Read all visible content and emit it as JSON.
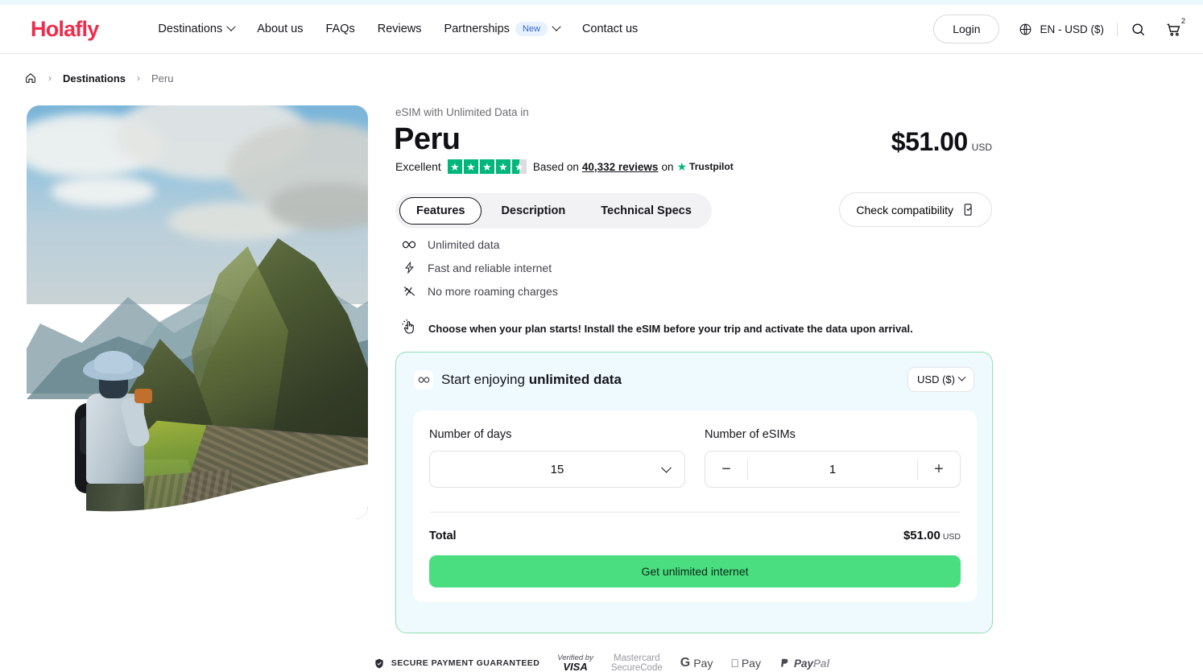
{
  "header": {
    "logo": "Holafly",
    "nav": [
      {
        "label": "Destinations",
        "has_chevron": true,
        "badge": null
      },
      {
        "label": "About us",
        "has_chevron": false,
        "badge": null
      },
      {
        "label": "FAQs",
        "has_chevron": false,
        "badge": null
      },
      {
        "label": "Reviews",
        "has_chevron": false,
        "badge": null
      },
      {
        "label": "Partnerships",
        "has_chevron": true,
        "badge": "New"
      },
      {
        "label": "Contact us",
        "has_chevron": false,
        "badge": null
      }
    ],
    "login_label": "Login",
    "locale": "EN - USD ($)",
    "locale_icon": "globe-icon",
    "search_icon": "search-icon",
    "cart_icon": "cart-icon",
    "cart_count": "2"
  },
  "breadcrumb": {
    "home_icon": "home-icon",
    "separator": "›",
    "items": [
      {
        "label": "Destinations"
      },
      {
        "label": "Peru"
      }
    ]
  },
  "hero": {
    "alt": "photographer-overlooking-machu-picchu"
  },
  "product": {
    "eyebrow": "eSIM with Unlimited Data in",
    "title": "Peru",
    "price_amount": "$51.00",
    "price_currency": "USD"
  },
  "rating": {
    "word": "Excellent",
    "stars": 4.5,
    "star_color": "#00b67a",
    "prefix": "Based on",
    "reviews_count": "40,332 reviews",
    "on_label": "on",
    "brand": "Trustpilot"
  },
  "tabs": [
    {
      "label": "Features",
      "active": true
    },
    {
      "label": "Description",
      "active": false
    },
    {
      "label": "Technical Specs",
      "active": false
    }
  ],
  "compatibility": {
    "label": "Check compatibility",
    "icon": "phone-check-icon"
  },
  "features": [
    {
      "icon": "infinity-icon",
      "label": "Unlimited data"
    },
    {
      "icon": "bolt-icon",
      "label": "Fast and reliable internet"
    },
    {
      "icon": "no-roaming-icon",
      "label": "No more roaming charges"
    }
  ],
  "notice": {
    "icon": "tap-hand-icon",
    "text": "Choose when your plan starts! Install the eSIM before your trip and activate the data upon arrival."
  },
  "buy": {
    "icon": "infinity-icon",
    "title_lead": "Start enjoying ",
    "title_bold": "unlimited data",
    "currency_selector": "USD ($)",
    "days_label": "Number of days",
    "days_value": "15",
    "esims_label": "Number of eSIMs",
    "esims_value": "1",
    "minus_label": "−",
    "plus_label": "+",
    "total_label": "Total",
    "total_value": "$51.00",
    "total_currency": "USD",
    "cta_label": "Get unlimited internet",
    "cta_color": "#4ade80",
    "card_border_color": "#8fe0b0",
    "card_bg_color": "#effafe"
  },
  "payments": {
    "secure_icon": "shield-check-icon",
    "secure_label": "SECURE PAYMENT GUARANTEED",
    "visa_top": "Verified by",
    "visa_bottom": "VISA",
    "mastercard_1": "Mastercard",
    "mastercard_2": "SecureCode",
    "gpay_g": "G",
    "gpay_text": "Pay",
    "apay_icon": "apple-icon",
    "apay_text": "Pay",
    "paypal_icon": "paypal-icon",
    "paypal_pay": "Pay",
    "paypal_pal": "Pal"
  }
}
